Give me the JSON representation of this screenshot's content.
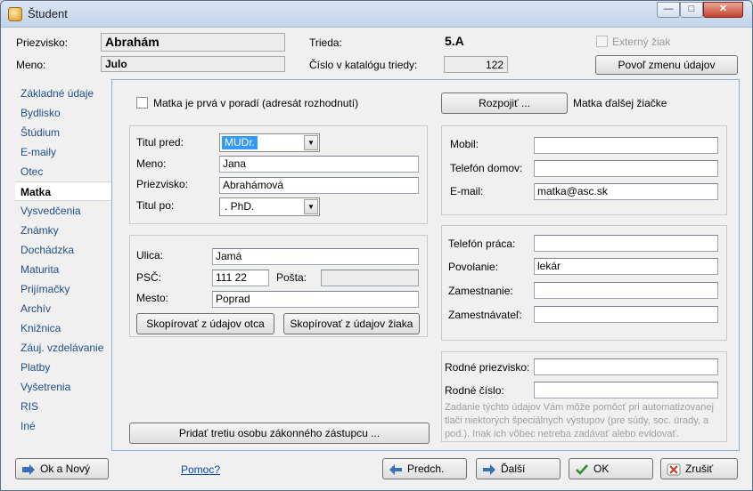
{
  "window": {
    "title": "Študent",
    "minimize": "—",
    "maximize": "□",
    "close": "✕"
  },
  "header": {
    "surname_label": "Priezvisko:",
    "surname_value": "Abrahám",
    "name_label": "Meno:",
    "name_value": "Julo",
    "class_label": "Trieda:",
    "class_value": "5.A",
    "catalog_label": "Číslo v katalógu triedy:",
    "catalog_value": "122",
    "external_label": "Externý žiak",
    "allow_edit_button": "Povoľ zmenu údajov"
  },
  "nav": {
    "items": [
      {
        "label": "Základné údaje"
      },
      {
        "label": "Bydlisko"
      },
      {
        "label": "Štúdium"
      },
      {
        "label": "E-maily"
      },
      {
        "label": "Otec"
      },
      {
        "label": "Matka"
      },
      {
        "label": "Vysvedčenia"
      },
      {
        "label": "Známky"
      },
      {
        "label": "Dochádzka"
      },
      {
        "label": "Maturita"
      },
      {
        "label": "Prijímačky"
      },
      {
        "label": "Archív"
      },
      {
        "label": "Knižnica"
      },
      {
        "label": "Záuj. vzdelávanie"
      },
      {
        "label": "Platby"
      },
      {
        "label": "Vyšetrenia"
      },
      {
        "label": "RIS"
      },
      {
        "label": "Iné"
      }
    ],
    "active": "Matka"
  },
  "form": {
    "first_recipient_label": "Matka je prvá v poradí (adresát rozhodnutí)",
    "split_button": "Rozpojiť ...",
    "split_note": "Matka ďalšej žiačke",
    "title_before_label": "Titul pred:",
    "title_before_value": "MUDr.",
    "first_name_label": "Meno:",
    "first_name_value": "Jana",
    "surname_label": "Priezvisko:",
    "surname_value": "Abrahámová",
    "title_after_label": "Titul po:",
    "title_after_value": ". PhD.",
    "street_label": "Ulica:",
    "street_value": "Jamá",
    "zip_label": "PSČ:",
    "zip_value": "111 22",
    "post_label": "Pošta:",
    "post_value": "",
    "city_label": "Mesto:",
    "city_value": "Poprad",
    "copy_father_button": "Skopírovať z údajov otca",
    "copy_student_button": "Skopírovať z údajov žiaka",
    "add_guardian_button": "Pridať tretiu osobu zákonného zástupcu ...",
    "mobile_label": "Mobil:",
    "mobile_value": "",
    "home_phone_label": "Telefón domov:",
    "home_phone_value": "",
    "email_label": "E-mail:",
    "email_value": "matka@asc.sk",
    "work_phone_label": "Telefón práca:",
    "work_phone_value": "",
    "occupation_label": "Povolanie:",
    "occupation_value": "lekár",
    "employment_label": "Zamestnanie:",
    "employment_value": "",
    "employer_label": "Zamestnávateľ:",
    "employer_value": "",
    "birth_surname_label": "Rodné priezvisko:",
    "birth_surname_value": "",
    "birth_number_label": "Rodné číslo:",
    "birth_number_value": "",
    "hint_text": "Zadanie týchto údajov Vám môže pomôcť pri automatizovanej tlači niektorých špeciálnych výstupov (pre súdy, soc. úrady, a pod.). Inak ich vôbec netreba zadávať alebo evidovať."
  },
  "footer": {
    "ok_new_button": "Ok a Nový",
    "help_link": "Pomoc?",
    "prev_button": "Predch.",
    "next_button": "Ďalší",
    "ok_button": "OK",
    "cancel_button": "Zrušiť"
  },
  "colors": {
    "accent": "#3399ff",
    "nav_link": "#1f4e8c",
    "panel_border": "#8ab0d8"
  }
}
